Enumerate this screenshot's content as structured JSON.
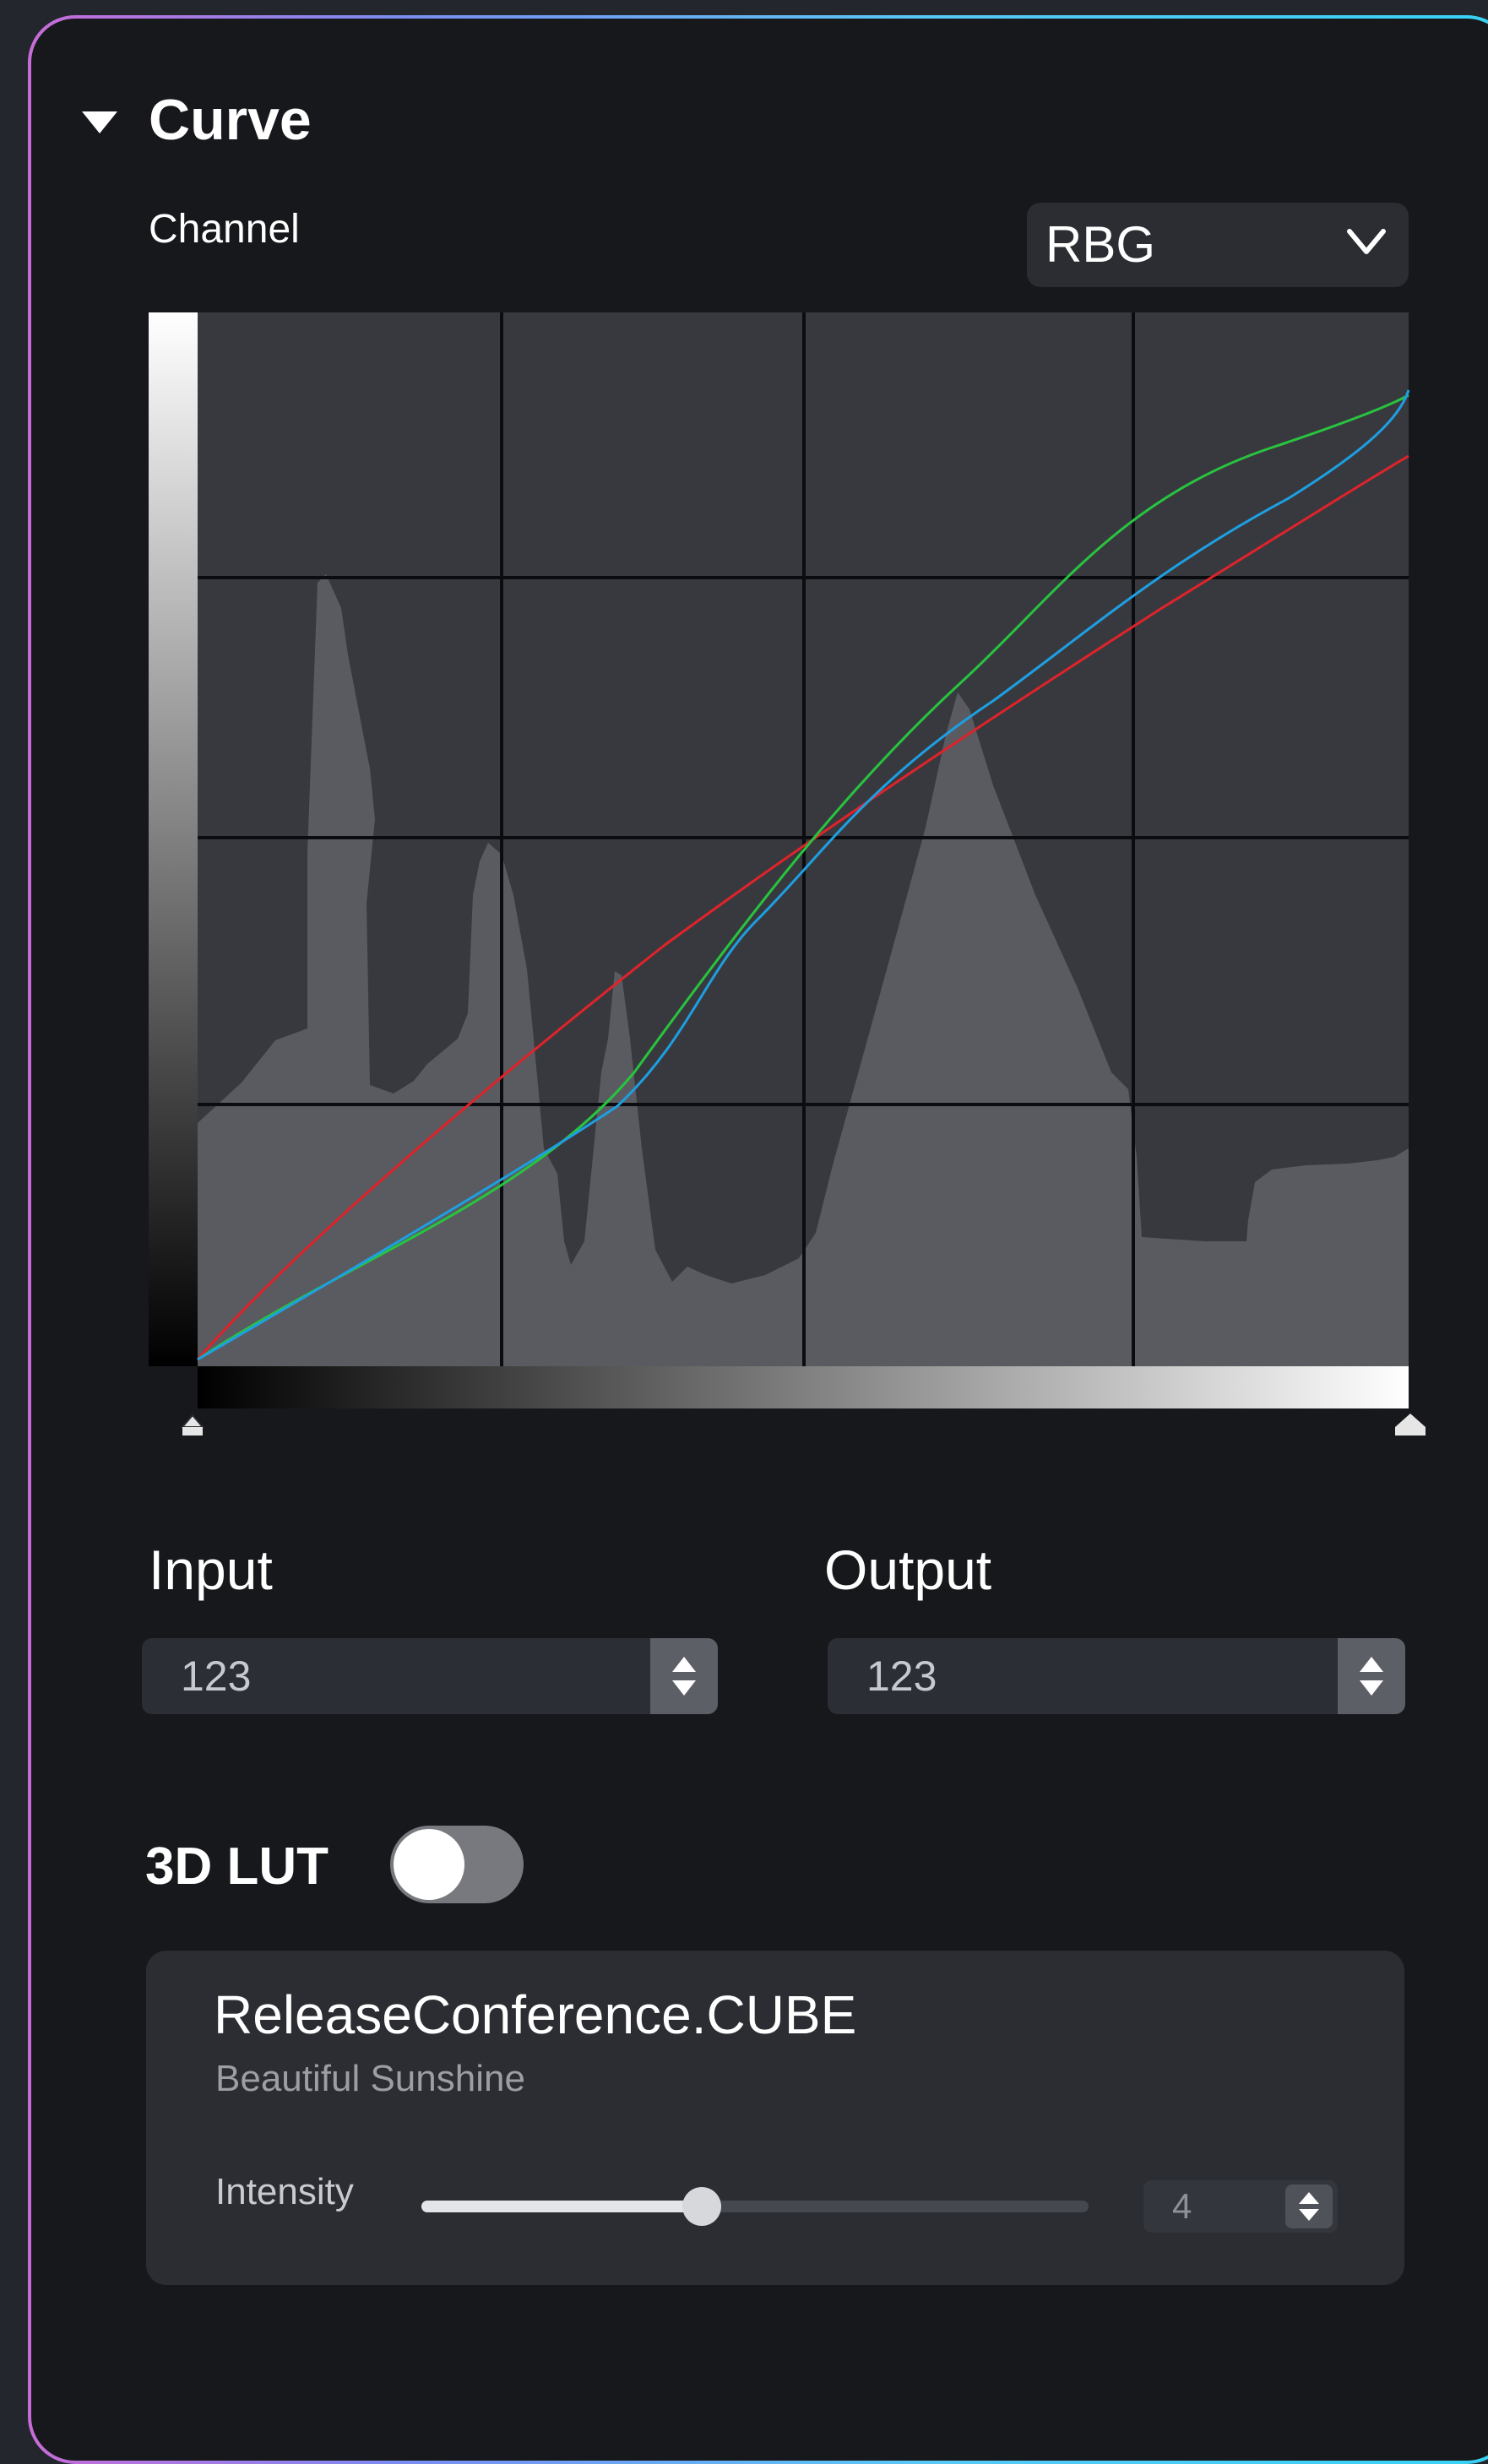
{
  "curve": {
    "title": "Curve",
    "collapse_icon": "triangle-down-icon",
    "channel_label": "Channel",
    "channel_value": "RBG",
    "chevron_icon": "chevron-down-icon",
    "colors": {
      "red": "#e0232a",
      "green": "#27c43f",
      "blue": "#1d9fe2",
      "grid_bg": "#38393e",
      "histogram": "#5a5b60"
    },
    "input_label": "Input",
    "input_value": "123",
    "output_label": "Output",
    "output_value": "123"
  },
  "lut": {
    "label": "3D LUT",
    "toggle_on": false,
    "file_name": "ReleaseConference.CUBE",
    "description": "Beautiful Sunshine",
    "intensity_label": "Intensity",
    "intensity_value": "4",
    "intensity_fraction": 0.42
  },
  "theme": {
    "accent_gradient": [
      "#c86bd7",
      "#59c7f4",
      "#36d2f4"
    ],
    "panel_bg": "#16181c"
  }
}
